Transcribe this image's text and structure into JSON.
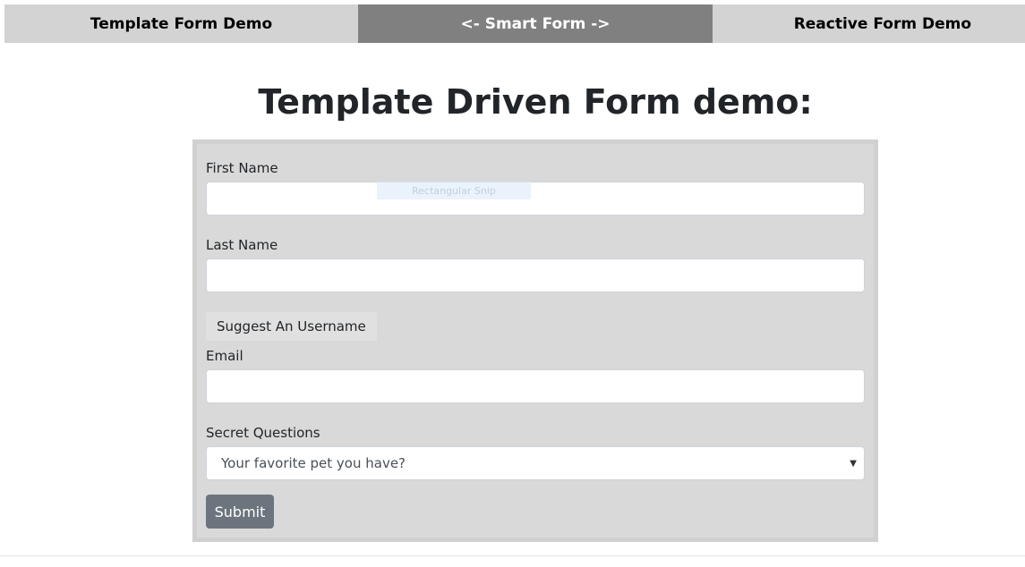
{
  "nav": {
    "tabs": [
      {
        "label": "Template Form Demo"
      },
      {
        "label": "<- Smart Form ->"
      },
      {
        "label": "Reactive Form Demo"
      }
    ]
  },
  "page": {
    "title": "Template Driven Form demo:"
  },
  "form": {
    "first_name_label": "First Name",
    "first_name_value": "",
    "last_name_label": "Last Name",
    "last_name_value": "",
    "suggest_button_label": "Suggest An Username",
    "email_label": "Email",
    "email_value": "",
    "secret_questions_label": "Secret Questions",
    "secret_questions_selected": "Your favorite pet you have?",
    "submit_label": "Submit"
  },
  "overlay": {
    "snip_label": "Rectangular Snip"
  },
  "colors": {
    "tab_inactive": "#d3d3d3",
    "tab_active": "#808080",
    "panel_bg": "#d9d9d9",
    "submit_bg": "#6c757d"
  }
}
